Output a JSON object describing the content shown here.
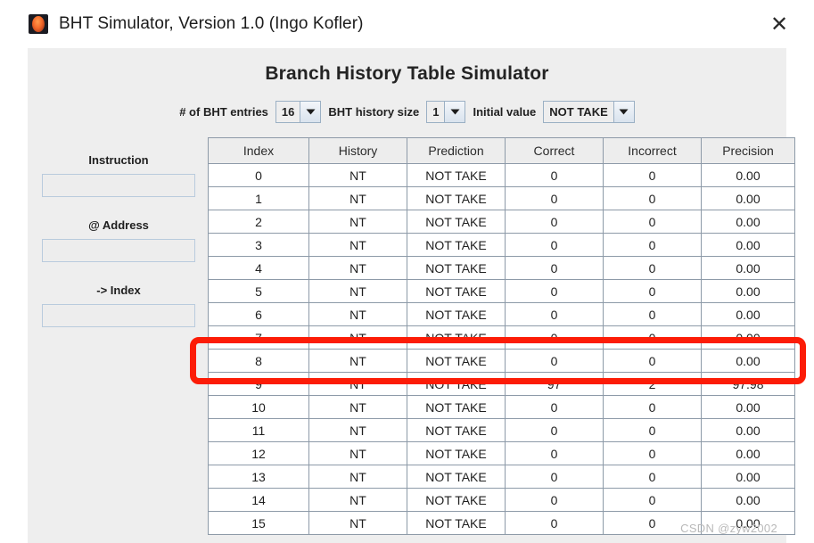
{
  "window": {
    "title": "BHT Simulator, Version 1.0 (Ingo Kofler)",
    "close_label": "✕",
    "icon": "bht-app-icon"
  },
  "heading": "Branch History Table Simulator",
  "config": {
    "entries_label": "# of BHT entries",
    "entries_value": "16",
    "history_label": "BHT history size",
    "history_value": "1",
    "initial_label": "Initial value",
    "initial_value": "NOT TAKE"
  },
  "left_panel": {
    "instruction_label": "Instruction",
    "instruction_value": "",
    "address_label": "@ Address",
    "address_value": "",
    "index_label": "-> Index",
    "index_value": ""
  },
  "table": {
    "columns": [
      "Index",
      "History",
      "Prediction",
      "Correct",
      "Incorrect",
      "Precision"
    ],
    "rows": [
      [
        "0",
        "NT",
        "NOT TAKE",
        "0",
        "0",
        "0.00"
      ],
      [
        "1",
        "NT",
        "NOT TAKE",
        "0",
        "0",
        "0.00"
      ],
      [
        "2",
        "NT",
        "NOT TAKE",
        "0",
        "0",
        "0.00"
      ],
      [
        "3",
        "NT",
        "NOT TAKE",
        "0",
        "0",
        "0.00"
      ],
      [
        "4",
        "NT",
        "NOT TAKE",
        "0",
        "0",
        "0.00"
      ],
      [
        "5",
        "NT",
        "NOT TAKE",
        "0",
        "0",
        "0.00"
      ],
      [
        "6",
        "NT",
        "NOT TAKE",
        "0",
        "0",
        "0.00"
      ],
      [
        "7",
        "NT",
        "NOT TAKE",
        "0",
        "0",
        "0.00"
      ],
      [
        "8",
        "NT",
        "NOT TAKE",
        "0",
        "0",
        "0.00"
      ],
      [
        "9",
        "NT",
        "NOT TAKE",
        "97",
        "2",
        "97.98"
      ],
      [
        "10",
        "NT",
        "NOT TAKE",
        "0",
        "0",
        "0.00"
      ],
      [
        "11",
        "NT",
        "NOT TAKE",
        "0",
        "0",
        "0.00"
      ],
      [
        "12",
        "NT",
        "NOT TAKE",
        "0",
        "0",
        "0.00"
      ],
      [
        "13",
        "NT",
        "NOT TAKE",
        "0",
        "0",
        "0.00"
      ],
      [
        "14",
        "NT",
        "NOT TAKE",
        "0",
        "0",
        "0.00"
      ],
      [
        "15",
        "NT",
        "NOT TAKE",
        "0",
        "0",
        "0.00"
      ]
    ]
  },
  "annotation": {
    "highlight_color": "#fc1c07",
    "highlighted_row_index": "9"
  },
  "watermark": "CSDN @zyw2002"
}
